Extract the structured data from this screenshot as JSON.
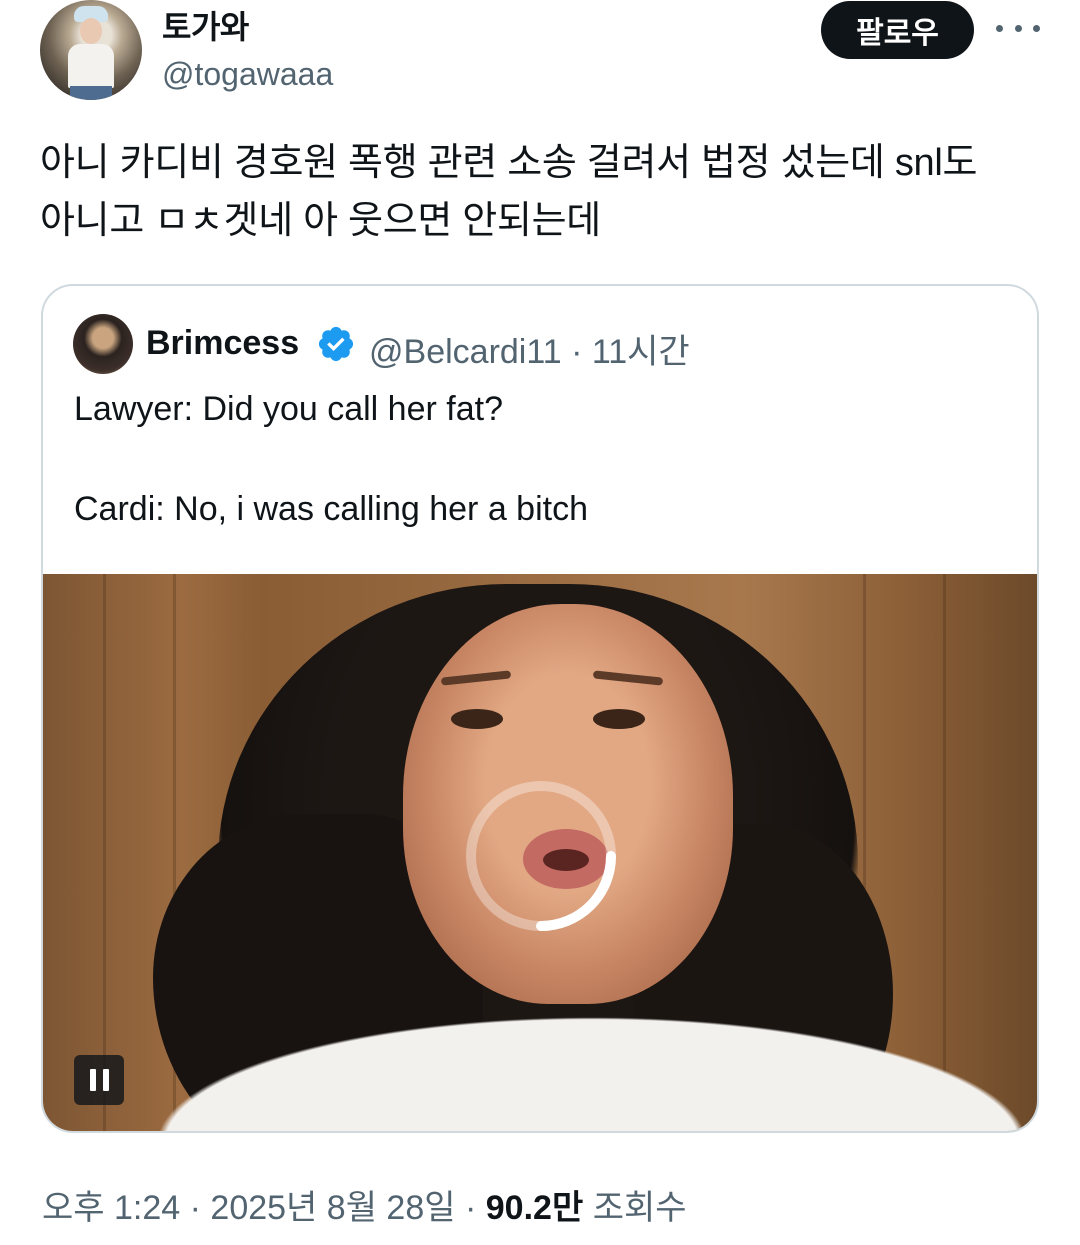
{
  "author": {
    "display_name": "토가와",
    "handle": "@togawaaa"
  },
  "actions": {
    "follow_label": "팔로우",
    "more_icon": "more-horizontal-icon"
  },
  "tweet": {
    "text_line1": "아니 카디비 경호원 폭행 관련 소송 걸려서 법정 섰는데 snl도",
    "text_line2": "아니고 ㅁㅊ겟네 아 웃으면 안되는데"
  },
  "quote": {
    "display_name": "Brimcess",
    "verified_icon": "verified-badge-icon",
    "verified_color": "#1d9bf0",
    "meta": "@Belcardi11 · 11시간",
    "text": "Lawyer: Did you call her fat?\n\nCardi: No, i was calling her a bitch",
    "media": {
      "loading_icon": "loading-spinner-icon",
      "pause_icon": "pause-icon"
    }
  },
  "footer": {
    "time": "오후 1:24",
    "date": "2025년 8월 28일",
    "separator": "·",
    "views_count": "90.2만",
    "views_label": "조회수"
  }
}
